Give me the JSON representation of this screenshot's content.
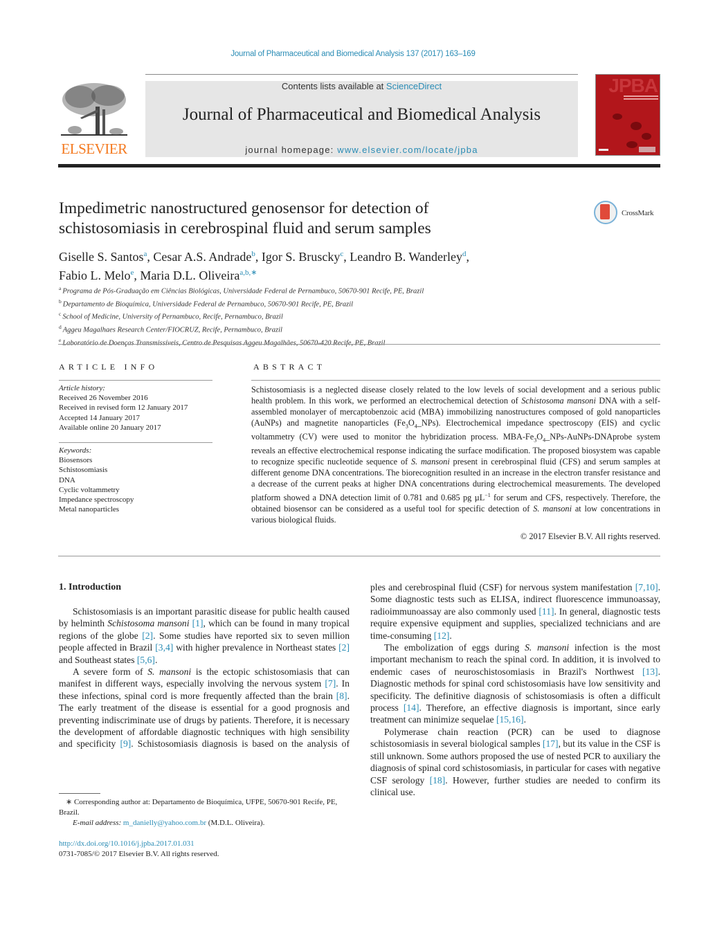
{
  "journal_ref": "Journal of Pharmaceutical and Biomedical Analysis 137 (2017) 163–169",
  "publisher": {
    "logo_text": "ELSEVIER",
    "brand_color": "#f47a20"
  },
  "masthead": {
    "contents_prefix": "Contents lists available at ",
    "contents_link": "ScienceDirect",
    "journal_title": "Journal of Pharmaceutical and Biomedical Analysis",
    "homepage_prefix": "journal homepage: ",
    "homepage_link": "www.elsevier.com/locate/jpba"
  },
  "cover": {
    "acronym": "JPBA",
    "color": "#b2161b"
  },
  "crossmark": {
    "label": "CrossMark"
  },
  "article": {
    "title_line1": "Impedimetric nanostructured genosensor for detection of",
    "title_line2": "schistosomiasis in cerebrospinal fluid and serum samples",
    "authors": [
      {
        "name": "Giselle S. Santos",
        "sup": "a",
        "sep": ", "
      },
      {
        "name": "Cesar A.S. Andrade",
        "sup": "b",
        "sep": ", "
      },
      {
        "name": "Igor S. Bruscky",
        "sup": "c",
        "sep": ", "
      },
      {
        "name": "Leandro B. Wanderley",
        "sup": "d",
        "sep": ","
      },
      {
        "name": "Fabio L. Melo",
        "sup": "e",
        "sep": ", "
      },
      {
        "name": "Maria D.L. Oliveira",
        "sup": "a,b,∗",
        "sep": ""
      }
    ],
    "affiliations": [
      {
        "key": "a",
        "text": "Programa de Pós-Graduação em Ciências Biológicas, Universidade Federal de Pernambuco, 50670-901 Recife, PE, Brazil"
      },
      {
        "key": "b",
        "text": "Departamento de Bioquímica, Universidade Federal de Pernambuco, 50670-901 Recife, PE, Brazil"
      },
      {
        "key": "c",
        "text": "School of Medicine, University of Pernambuco, Recife, Pernambuco, Brazil"
      },
      {
        "key": "d",
        "text": "Aggeu Magalhaes Research Center/FIOCRUZ, Recife, Pernambuco, Brazil"
      },
      {
        "key": "e",
        "text": "Laboratório de Doenças Transmissíveis, Centro de Pesquisas Aggeu Magalhães, 50670-420 Recife, PE, Brazil"
      }
    ]
  },
  "article_info": {
    "heading": "ARTICLE INFO",
    "history_label": "Article history:",
    "history": [
      "Received 26 November 2016",
      "Received in revised form 12 January 2017",
      "Accepted 14 January 2017",
      "Available online 20 January 2017"
    ],
    "keywords_label": "Keywords:",
    "keywords": [
      "Biosensors",
      "Schistosomiasis",
      "DNA",
      "Cyclic voltammetry",
      "Impedance spectroscopy",
      "Metal nanoparticles"
    ]
  },
  "abstract": {
    "heading": "ABSTRACT",
    "t1": "Schistosomiasis is a neglected disease closely related to the low levels of social development and a serious public health problem. In this work, we performed an electrochemical detection of ",
    "i1": "Schistosoma mansoni",
    "t2": " DNA with a self-assembled monolayer of mercaptobenzoic acid (MBA) immobilizing nanostructures composed of gold nanoparticles (AuNPs) and magnetite nanoparticles (Fe",
    "s1": "3",
    "t3": "O",
    "s2": "4",
    "t4": "_NPs). Electrochemical impedance spectroscopy (EIS) and cyclic voltammetry (CV) were used to monitor the hybridization process. MBA-Fe",
    "s3": "3",
    "t5": "O",
    "s4": "4",
    "t6": "_NPs-AuNPs-DNAprobe system reveals an effective electrochemical response indicating the surface modification. The proposed biosystem was capable to recognize specific nucleotide sequence of ",
    "i2": "S. mansoni",
    "t7": " present in cerebrospinal fluid (CFS) and serum samples at different genome DNA concentrations. The biorecognition resulted in an increase in the electron transfer resistance and a decrease of the current peaks at higher DNA concentrations during electrochemical measurements. The developed platform showed a DNA detection limit of 0.781 and 0.685 pg µL",
    "sup1": "−1",
    "t8": " for serum and CFS, respectively. Therefore, the obtained biosensor can be considered as a useful tool for specific detection of ",
    "i3": "S. mansoni",
    "t9": " at low concentrations in various biological fluids.",
    "copyright": "© 2017 Elsevier B.V. All rights reserved."
  },
  "intro": {
    "heading": "1.  Introduction",
    "p1": {
      "a": "Schistosomiasis is an important parasitic disease for public health caused by helminth ",
      "i": "Schistosoma mansoni",
      "b": " ",
      "r1": "[1]",
      "c": ", which can be found in many tropical regions of the globe ",
      "r2": "[2]",
      "d": ". Some studies have reported six to seven million people affected in Brazil ",
      "r3": "[3,4]",
      "e": " with higher prevalence in Northeast states ",
      "r4": "[2]",
      "f": " and Southeast states ",
      "r5": "[5,6]",
      "g": "."
    },
    "p2": {
      "a": "A severe form of ",
      "i": "S. mansoni",
      "b": " is the ectopic schistosomiasis that can manifest in different ways, especially involving the nervous system ",
      "r1": "[7]",
      "c": ". In these infections, spinal cord is more frequently affected than the brain ",
      "r2": "[8]",
      "d": ". The early treatment of the disease is essential for a good prognosis and preventing indiscriminate use of drugs by patients. Therefore, it is necessary the development of affordable diagnostic techniques with high sensibility and specificity ",
      "r3": "[9]",
      "e": ". Schistosomiasis diagnosis is based on the analysis of faecal samples and cerebrospinal fluid (CSF) for nervous system manifestation ",
      "r4": "[7,10]",
      "f": ". Some diagnostic tests such as ELISA, indirect fluorescence immunoassay, radioimmunoassay are also commonly used ",
      "r5": "[11]",
      "g": ". In general, diagnostic tests require expensive equipment and supplies, specialized technicians and are time-consuming ",
      "r6": "[12]",
      "h": "."
    },
    "p3": {
      "a": "The embolization of eggs during ",
      "i": "S. mansoni",
      "b": " infection is the most important mechanism to reach the spinal cord. In addition, it is involved to endemic cases of neuroschistosomiasis in Brazil's Northwest ",
      "r1": "[13]",
      "c": ". Diagnostic methods for spinal cord schistosomiasis have low sensitivity and specificity. The definitive diagnosis of schistosomiasis is often a difficult process ",
      "r2": "[14]",
      "d": ". Therefore, an effective diagnosis is important, since early treatment can minimize sequelae ",
      "r3": "[15,16]",
      "e": "."
    },
    "p4": {
      "a": "Polymerase chain reaction (PCR) can be used to diagnose schistosomiasis in several biological samples ",
      "r1": "[17]",
      "b": ", but its value in the CSF is still unknown. Some authors proposed the use of nested PCR to auxiliary the diagnosis of spinal cord schistosomiasis, in particular for cases with negative CSF serology ",
      "r2": "[18]",
      "c": ". However, further studies are needed to confirm its clinical use."
    }
  },
  "footnotes": {
    "corresponding": "∗  Corresponding author at: Departamento de Bioquímica, UFPE, 50670-901 Recife, PE, Brazil.",
    "email_label": "E-mail address:",
    "email": "m_danielly@yahoo.com.br",
    "email_suffix": " (M.D.L. Oliveira).",
    "doi": "http://dx.doi.org/10.1016/j.jpba.2017.01.031",
    "issn": "0731-7085/© 2017 Elsevier B.V. All rights reserved."
  }
}
